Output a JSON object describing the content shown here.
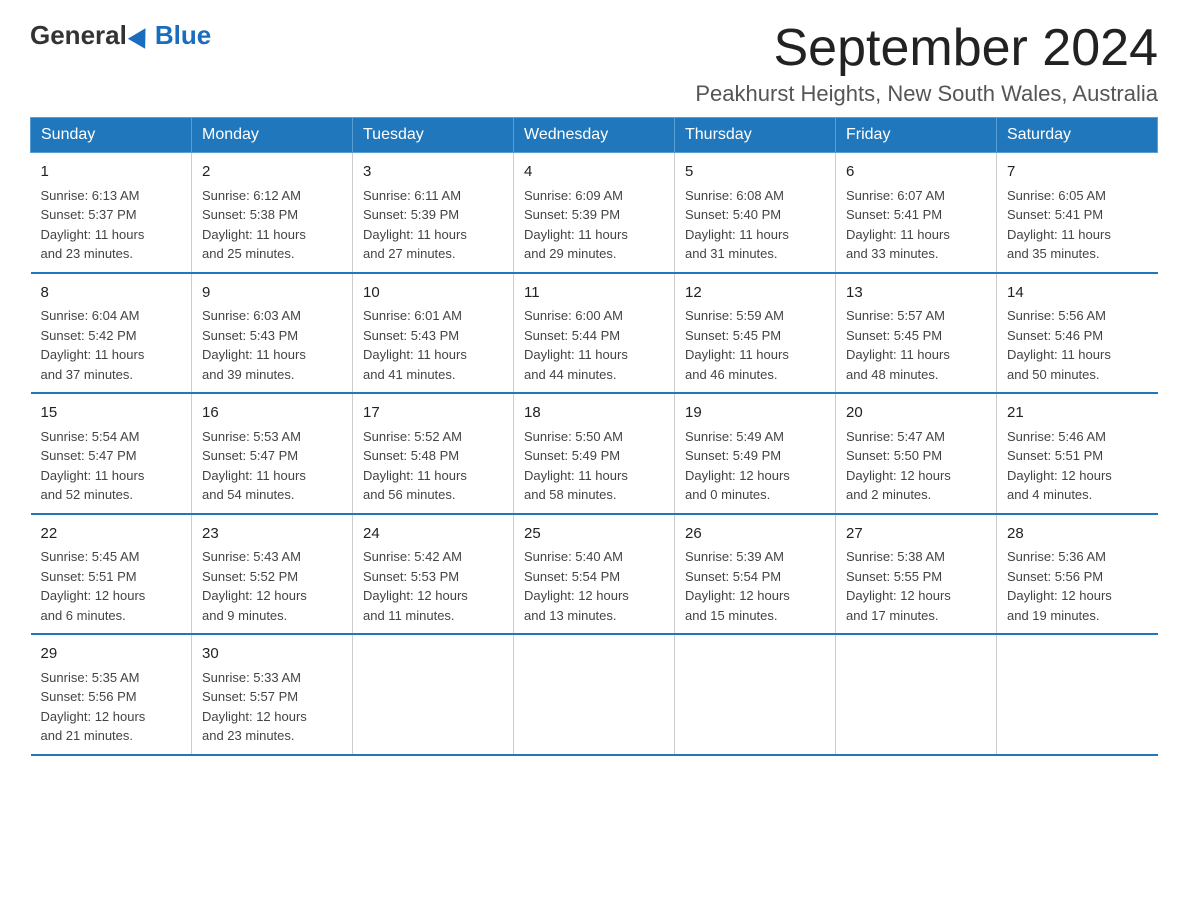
{
  "header": {
    "logo_general": "General",
    "logo_blue": "Blue",
    "month_title": "September 2024",
    "location": "Peakhurst Heights, New South Wales, Australia"
  },
  "days_of_week": [
    "Sunday",
    "Monday",
    "Tuesday",
    "Wednesday",
    "Thursday",
    "Friday",
    "Saturday"
  ],
  "weeks": [
    [
      {
        "day": "1",
        "sunrise": "6:13 AM",
        "sunset": "5:37 PM",
        "daylight": "11 hours and 23 minutes."
      },
      {
        "day": "2",
        "sunrise": "6:12 AM",
        "sunset": "5:38 PM",
        "daylight": "11 hours and 25 minutes."
      },
      {
        "day": "3",
        "sunrise": "6:11 AM",
        "sunset": "5:39 PM",
        "daylight": "11 hours and 27 minutes."
      },
      {
        "day": "4",
        "sunrise": "6:09 AM",
        "sunset": "5:39 PM",
        "daylight": "11 hours and 29 minutes."
      },
      {
        "day": "5",
        "sunrise": "6:08 AM",
        "sunset": "5:40 PM",
        "daylight": "11 hours and 31 minutes."
      },
      {
        "day": "6",
        "sunrise": "6:07 AM",
        "sunset": "5:41 PM",
        "daylight": "11 hours and 33 minutes."
      },
      {
        "day": "7",
        "sunrise": "6:05 AM",
        "sunset": "5:41 PM",
        "daylight": "11 hours and 35 minutes."
      }
    ],
    [
      {
        "day": "8",
        "sunrise": "6:04 AM",
        "sunset": "5:42 PM",
        "daylight": "11 hours and 37 minutes."
      },
      {
        "day": "9",
        "sunrise": "6:03 AM",
        "sunset": "5:43 PM",
        "daylight": "11 hours and 39 minutes."
      },
      {
        "day": "10",
        "sunrise": "6:01 AM",
        "sunset": "5:43 PM",
        "daylight": "11 hours and 41 minutes."
      },
      {
        "day": "11",
        "sunrise": "6:00 AM",
        "sunset": "5:44 PM",
        "daylight": "11 hours and 44 minutes."
      },
      {
        "day": "12",
        "sunrise": "5:59 AM",
        "sunset": "5:45 PM",
        "daylight": "11 hours and 46 minutes."
      },
      {
        "day": "13",
        "sunrise": "5:57 AM",
        "sunset": "5:45 PM",
        "daylight": "11 hours and 48 minutes."
      },
      {
        "day": "14",
        "sunrise": "5:56 AM",
        "sunset": "5:46 PM",
        "daylight": "11 hours and 50 minutes."
      }
    ],
    [
      {
        "day": "15",
        "sunrise": "5:54 AM",
        "sunset": "5:47 PM",
        "daylight": "11 hours and 52 minutes."
      },
      {
        "day": "16",
        "sunrise": "5:53 AM",
        "sunset": "5:47 PM",
        "daylight": "11 hours and 54 minutes."
      },
      {
        "day": "17",
        "sunrise": "5:52 AM",
        "sunset": "5:48 PM",
        "daylight": "11 hours and 56 minutes."
      },
      {
        "day": "18",
        "sunrise": "5:50 AM",
        "sunset": "5:49 PM",
        "daylight": "11 hours and 58 minutes."
      },
      {
        "day": "19",
        "sunrise": "5:49 AM",
        "sunset": "5:49 PM",
        "daylight": "12 hours and 0 minutes."
      },
      {
        "day": "20",
        "sunrise": "5:47 AM",
        "sunset": "5:50 PM",
        "daylight": "12 hours and 2 minutes."
      },
      {
        "day": "21",
        "sunrise": "5:46 AM",
        "sunset": "5:51 PM",
        "daylight": "12 hours and 4 minutes."
      }
    ],
    [
      {
        "day": "22",
        "sunrise": "5:45 AM",
        "sunset": "5:51 PM",
        "daylight": "12 hours and 6 minutes."
      },
      {
        "day": "23",
        "sunrise": "5:43 AM",
        "sunset": "5:52 PM",
        "daylight": "12 hours and 9 minutes."
      },
      {
        "day": "24",
        "sunrise": "5:42 AM",
        "sunset": "5:53 PM",
        "daylight": "12 hours and 11 minutes."
      },
      {
        "day": "25",
        "sunrise": "5:40 AM",
        "sunset": "5:54 PM",
        "daylight": "12 hours and 13 minutes."
      },
      {
        "day": "26",
        "sunrise": "5:39 AM",
        "sunset": "5:54 PM",
        "daylight": "12 hours and 15 minutes."
      },
      {
        "day": "27",
        "sunrise": "5:38 AM",
        "sunset": "5:55 PM",
        "daylight": "12 hours and 17 minutes."
      },
      {
        "day": "28",
        "sunrise": "5:36 AM",
        "sunset": "5:56 PM",
        "daylight": "12 hours and 19 minutes."
      }
    ],
    [
      {
        "day": "29",
        "sunrise": "5:35 AM",
        "sunset": "5:56 PM",
        "daylight": "12 hours and 21 minutes."
      },
      {
        "day": "30",
        "sunrise": "5:33 AM",
        "sunset": "5:57 PM",
        "daylight": "12 hours and 23 minutes."
      },
      null,
      null,
      null,
      null,
      null
    ]
  ],
  "labels": {
    "sunrise": "Sunrise:",
    "sunset": "Sunset:",
    "daylight": "Daylight:"
  }
}
